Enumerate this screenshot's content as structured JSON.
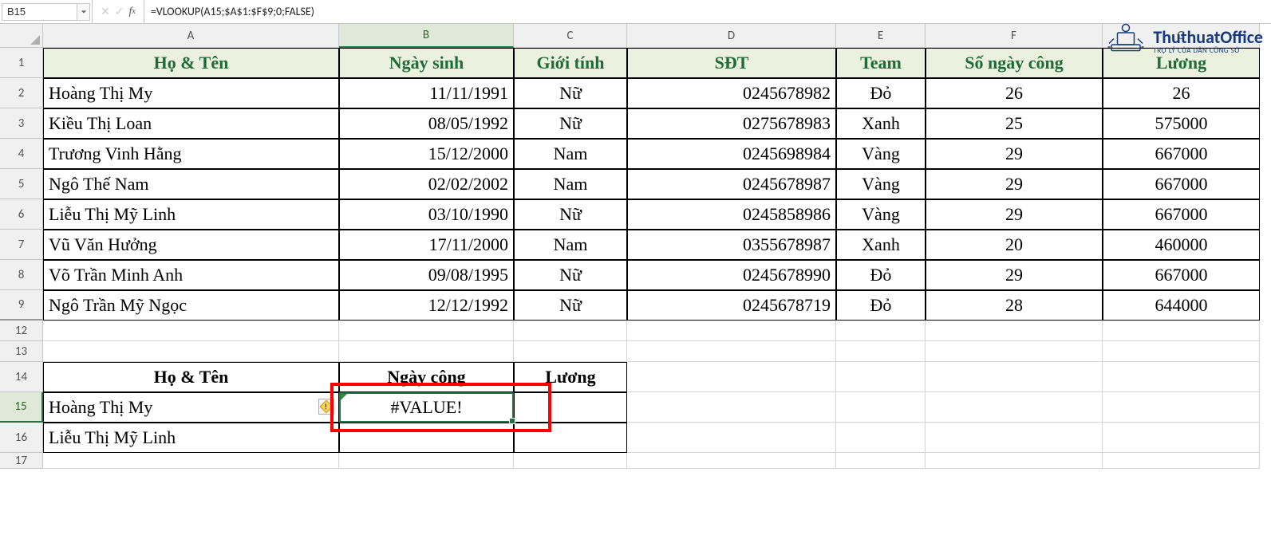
{
  "name_box": "B15",
  "formula": "=VLOOKUP(A15;$A$1:$F$9;0;FALSE)",
  "logo": {
    "name": "ThuthuatOffice",
    "sub": "TRỢ LÝ CỦA DÂN CÔNG SỞ"
  },
  "columns": [
    "A",
    "B",
    "C",
    "D",
    "E",
    "F",
    "G"
  ],
  "rows_visible": [
    "1",
    "2",
    "3",
    "4",
    "5",
    "6",
    "7",
    "8",
    "9",
    "12",
    "13",
    "14",
    "15",
    "16",
    "17"
  ],
  "selected_col": "B",
  "selected_row": "15",
  "headers_main": {
    "A": "Họ & Tên",
    "B": "Ngày sinh",
    "C": "Giới tính",
    "D": "SĐT",
    "E": "Team",
    "F": "Số ngày công",
    "G": "Lương"
  },
  "table": [
    {
      "A": "Hoàng Thị My",
      "B": "11/11/1991",
      "C": "Nữ",
      "D": "0245678982",
      "E": "Đỏ",
      "F": "26",
      "G": "26"
    },
    {
      "A": "Kiều Thị Loan",
      "B": "08/05/1992",
      "C": "Nữ",
      "D": "0275678983",
      "E": "Xanh",
      "F": "25",
      "G": "575000"
    },
    {
      "A": "Trương Vinh Hằng",
      "B": "15/12/2000",
      "C": "Nam",
      "D": "0245698984",
      "E": "Vàng",
      "F": "29",
      "G": "667000"
    },
    {
      "A": "Ngô Thế Nam",
      "B": "02/02/2002",
      "C": "Nam",
      "D": "0245678987",
      "E": "Vàng",
      "F": "29",
      "G": "667000"
    },
    {
      "A": "Liễu Thị Mỹ Linh",
      "B": "03/10/1990",
      "C": "Nữ",
      "D": "0245858986",
      "E": "Vàng",
      "F": "29",
      "G": "667000"
    },
    {
      "A": "Vũ Văn Hưởng",
      "B": "17/11/2000",
      "C": "Nam",
      "D": "0355678987",
      "E": "Xanh",
      "F": "20",
      "G": "460000"
    },
    {
      "A": "Võ Trần Minh Anh",
      "B": "09/08/1995",
      "C": "Nữ",
      "D": "0245678990",
      "E": "Đỏ",
      "F": "29",
      "G": "667000"
    },
    {
      "A": "Ngô Trần Mỹ Ngọc",
      "B": "12/12/1992",
      "C": "Nữ",
      "D": "0245678719",
      "E": "Đỏ",
      "F": "28",
      "G": "644000"
    }
  ],
  "headers_second": {
    "A": "Họ & Tên",
    "B": "Ngày công",
    "C": "Lương"
  },
  "table2": [
    {
      "A": "Hoàng Thị My",
      "B": "#VALUE!",
      "C": ""
    },
    {
      "A": "Liễu Thị Mỹ Linh",
      "B": "",
      "C": ""
    }
  ],
  "error_cell_value": "#VALUE!"
}
